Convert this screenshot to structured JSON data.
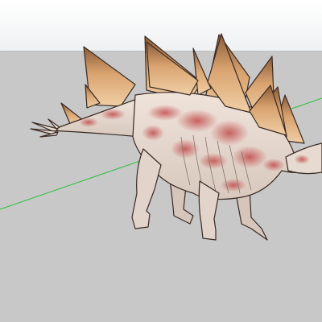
{
  "viewport": {
    "sky_color": "#f3f4f5",
    "ground_color": "#c8c8c8",
    "axis_color": "#2fbf3a",
    "model": {
      "icon": "stegosaurus-model",
      "body_color": "#e6d6cc",
      "pattern_color": "#c65a5a",
      "plate_color": "#c98e58",
      "outline_color": "#3a2a22"
    }
  }
}
